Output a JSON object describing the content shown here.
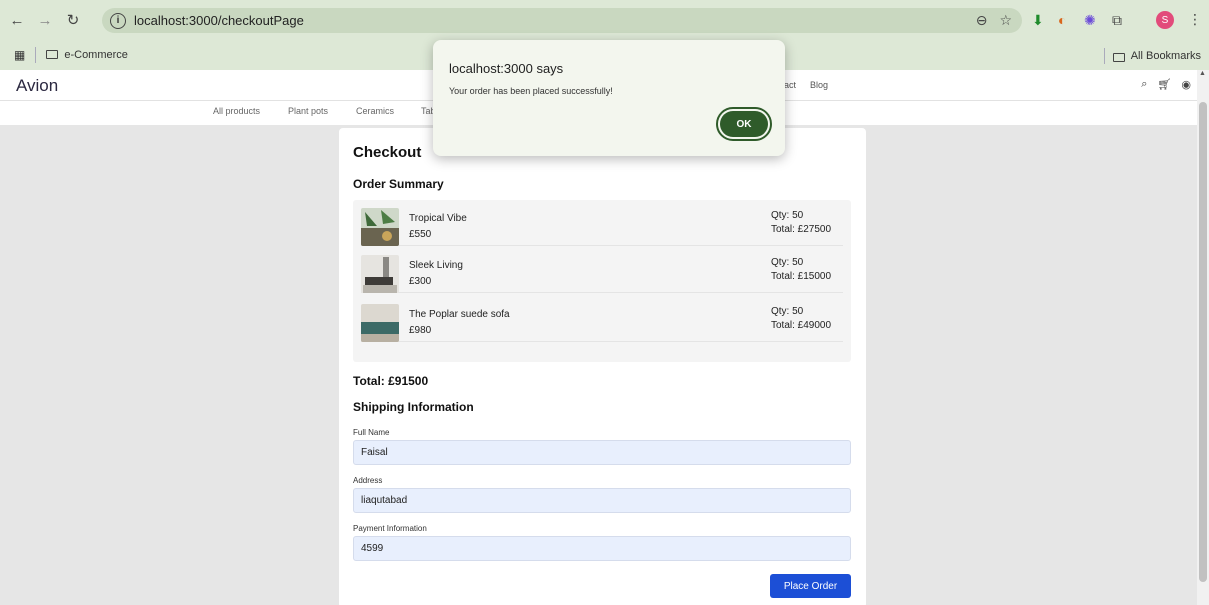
{
  "browser": {
    "url": "localhost:3000/checkoutPage",
    "bookmark_folder": "e-Commerce",
    "all_bookmarks": "All Bookmarks",
    "profile_initial": "S"
  },
  "site": {
    "brand": "Avion",
    "header_links": [
      "act",
      "Blog"
    ],
    "categories": [
      "All products",
      "Plant pots",
      "Ceramics",
      "Tab"
    ]
  },
  "checkout": {
    "title": "Checkout",
    "order_summary_heading": "Order Summary",
    "items": [
      {
        "name": "Tropical Vibe",
        "price": "£550",
        "qty": "Qty: 50",
        "total": "Total: £27500"
      },
      {
        "name": "Sleek Living",
        "price": "£300",
        "qty": "Qty: 50",
        "total": "Total: £15000"
      },
      {
        "name": "The Poplar suede sofa",
        "price": "£980",
        "qty": "Qty: 50",
        "total": "Total: £49000"
      }
    ],
    "grand_total": "Total: £91500",
    "shipping_heading": "Shipping Information",
    "fields": {
      "full_name": {
        "label": "Full Name",
        "value": "Faisal"
      },
      "address": {
        "label": "Address",
        "value": "liaqutabad"
      },
      "payment": {
        "label": "Payment Information",
        "value": "4599"
      }
    },
    "place_order_label": "Place Order"
  },
  "dialog": {
    "title": "localhost:3000 says",
    "message": "Your order has been placed successfully!",
    "ok_label": "OK"
  },
  "colors": {
    "chrome": "#dde8d6",
    "accent_button": "#1c4fd6",
    "dialog_ok": "#2f5b2a"
  }
}
